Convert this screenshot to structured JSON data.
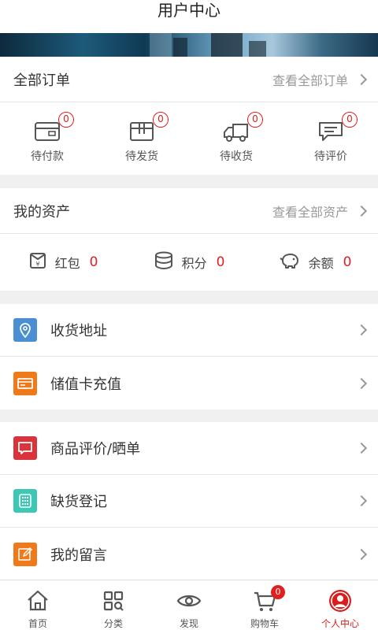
{
  "header": {
    "title": "用户中心"
  },
  "orders": {
    "title": "全部订单",
    "more": "查看全部订单",
    "items": [
      {
        "label": "待付款",
        "count": "0",
        "icon": "wallet-icon"
      },
      {
        "label": "待发货",
        "count": "0",
        "icon": "package-icon"
      },
      {
        "label": "待收货",
        "count": "0",
        "icon": "truck-icon"
      },
      {
        "label": "待评价",
        "count": "0",
        "icon": "comment-icon"
      }
    ]
  },
  "assets": {
    "title": "我的资产",
    "more": "查看全部资产",
    "items": [
      {
        "label": "红包",
        "value": "0",
        "icon": "red-envelope-icon"
      },
      {
        "label": "积分",
        "value": "0",
        "icon": "coins-icon"
      },
      {
        "label": "余额",
        "value": "0",
        "icon": "piggy-bank-icon"
      }
    ]
  },
  "menu1": [
    {
      "label": "收货地址",
      "icon": "location-pin-icon",
      "color": "#4a8fd4"
    },
    {
      "label": "储值卡充值",
      "icon": "card-icon",
      "color": "#f07a1a"
    }
  ],
  "menu2": [
    {
      "label": "商品评价/晒单",
      "icon": "message-icon",
      "color": "#d9343c"
    },
    {
      "label": "缺货登记",
      "icon": "grid-keypad-icon",
      "color": "#3fc7b5"
    },
    {
      "label": "我的留言",
      "icon": "edit-note-icon",
      "color": "#f07a1a"
    }
  ],
  "tabs": [
    {
      "label": "首页",
      "icon": "home-icon"
    },
    {
      "label": "分类",
      "icon": "category-icon"
    },
    {
      "label": "发现",
      "icon": "eye-icon"
    },
    {
      "label": "购物车",
      "icon": "cart-icon",
      "badge": "0"
    },
    {
      "label": "个人中心",
      "icon": "user-icon",
      "active": true
    }
  ],
  "colors": {
    "accent": "#e02020",
    "active_tab": "#d81e1e"
  }
}
